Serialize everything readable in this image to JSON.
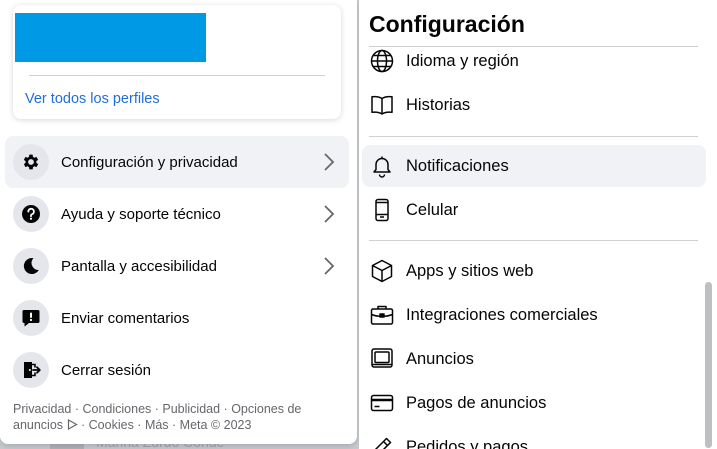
{
  "background": {
    "peek_text": "Marina Zurdo Conde"
  },
  "account_menu": {
    "profile_card": {
      "see_all_profiles": "Ver todos los perfiles"
    },
    "items": [
      {
        "label": "Configuración y privacidad",
        "icon": "gear-icon",
        "has_chevron": true
      },
      {
        "label": "Ayuda y soporte técnico",
        "icon": "question-icon",
        "has_chevron": true
      },
      {
        "label": "Pantalla y accesibilidad",
        "icon": "moon-icon",
        "has_chevron": true
      },
      {
        "label": "Enviar comentarios",
        "icon": "feedback-icon",
        "has_chevron": false
      },
      {
        "label": "Cerrar sesión",
        "icon": "logout-icon",
        "has_chevron": false
      }
    ],
    "footer": {
      "links": [
        "Privacidad",
        "Condiciones",
        "Publicidad",
        "Opciones de anuncios",
        "Cookies",
        "Más"
      ],
      "separator": " · ",
      "copyright": "Meta © 2023"
    }
  },
  "settings_panel": {
    "title": "Configuración",
    "items": [
      {
        "label": "Idioma y región",
        "icon": "globe-icon"
      },
      {
        "label": "Historias",
        "icon": "book-icon"
      },
      {
        "label": "Notificaciones",
        "icon": "bell-icon"
      },
      {
        "label": "Celular",
        "icon": "phone-icon"
      },
      {
        "label": "Apps y sitios web",
        "icon": "cube-icon"
      },
      {
        "label": "Integraciones comerciales",
        "icon": "briefcase-icon"
      },
      {
        "label": "Anuncios",
        "icon": "monitor-icon"
      },
      {
        "label": "Pagos de anuncios",
        "icon": "credit-card-icon"
      },
      {
        "label": "Pedidos y pagos",
        "icon": "pencil-icon"
      }
    ]
  },
  "colors": {
    "link": "#216fdb",
    "redacted_block": "#0099e6",
    "hover_background": "#f0f2f5",
    "icon_circle": "#e4e6eb"
  }
}
